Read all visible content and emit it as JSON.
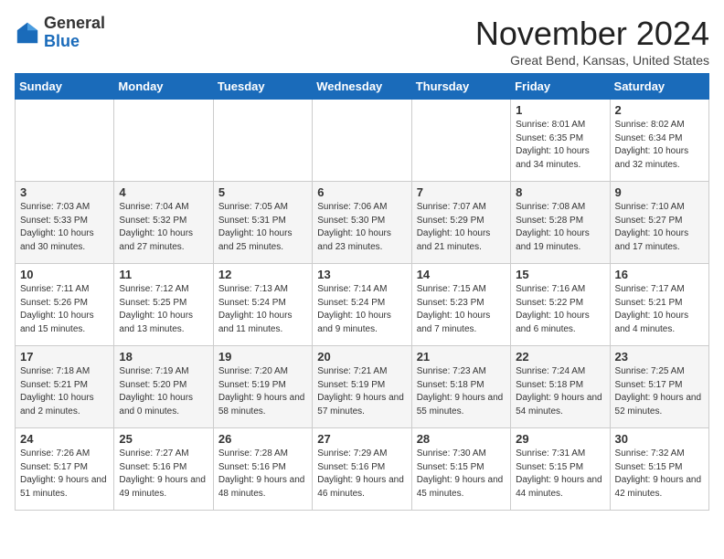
{
  "logo": {
    "general": "General",
    "blue": "Blue"
  },
  "title": "November 2024",
  "location": "Great Bend, Kansas, United States",
  "days_of_week": [
    "Sunday",
    "Monday",
    "Tuesday",
    "Wednesday",
    "Thursday",
    "Friday",
    "Saturday"
  ],
  "weeks": [
    [
      {
        "day": "",
        "info": ""
      },
      {
        "day": "",
        "info": ""
      },
      {
        "day": "",
        "info": ""
      },
      {
        "day": "",
        "info": ""
      },
      {
        "day": "",
        "info": ""
      },
      {
        "day": "1",
        "info": "Sunrise: 8:01 AM\nSunset: 6:35 PM\nDaylight: 10 hours and 34 minutes."
      },
      {
        "day": "2",
        "info": "Sunrise: 8:02 AM\nSunset: 6:34 PM\nDaylight: 10 hours and 32 minutes."
      }
    ],
    [
      {
        "day": "3",
        "info": "Sunrise: 7:03 AM\nSunset: 5:33 PM\nDaylight: 10 hours and 30 minutes."
      },
      {
        "day": "4",
        "info": "Sunrise: 7:04 AM\nSunset: 5:32 PM\nDaylight: 10 hours and 27 minutes."
      },
      {
        "day": "5",
        "info": "Sunrise: 7:05 AM\nSunset: 5:31 PM\nDaylight: 10 hours and 25 minutes."
      },
      {
        "day": "6",
        "info": "Sunrise: 7:06 AM\nSunset: 5:30 PM\nDaylight: 10 hours and 23 minutes."
      },
      {
        "day": "7",
        "info": "Sunrise: 7:07 AM\nSunset: 5:29 PM\nDaylight: 10 hours and 21 minutes."
      },
      {
        "day": "8",
        "info": "Sunrise: 7:08 AM\nSunset: 5:28 PM\nDaylight: 10 hours and 19 minutes."
      },
      {
        "day": "9",
        "info": "Sunrise: 7:10 AM\nSunset: 5:27 PM\nDaylight: 10 hours and 17 minutes."
      }
    ],
    [
      {
        "day": "10",
        "info": "Sunrise: 7:11 AM\nSunset: 5:26 PM\nDaylight: 10 hours and 15 minutes."
      },
      {
        "day": "11",
        "info": "Sunrise: 7:12 AM\nSunset: 5:25 PM\nDaylight: 10 hours and 13 minutes."
      },
      {
        "day": "12",
        "info": "Sunrise: 7:13 AM\nSunset: 5:24 PM\nDaylight: 10 hours and 11 minutes."
      },
      {
        "day": "13",
        "info": "Sunrise: 7:14 AM\nSunset: 5:24 PM\nDaylight: 10 hours and 9 minutes."
      },
      {
        "day": "14",
        "info": "Sunrise: 7:15 AM\nSunset: 5:23 PM\nDaylight: 10 hours and 7 minutes."
      },
      {
        "day": "15",
        "info": "Sunrise: 7:16 AM\nSunset: 5:22 PM\nDaylight: 10 hours and 6 minutes."
      },
      {
        "day": "16",
        "info": "Sunrise: 7:17 AM\nSunset: 5:21 PM\nDaylight: 10 hours and 4 minutes."
      }
    ],
    [
      {
        "day": "17",
        "info": "Sunrise: 7:18 AM\nSunset: 5:21 PM\nDaylight: 10 hours and 2 minutes."
      },
      {
        "day": "18",
        "info": "Sunrise: 7:19 AM\nSunset: 5:20 PM\nDaylight: 10 hours and 0 minutes."
      },
      {
        "day": "19",
        "info": "Sunrise: 7:20 AM\nSunset: 5:19 PM\nDaylight: 9 hours and 58 minutes."
      },
      {
        "day": "20",
        "info": "Sunrise: 7:21 AM\nSunset: 5:19 PM\nDaylight: 9 hours and 57 minutes."
      },
      {
        "day": "21",
        "info": "Sunrise: 7:23 AM\nSunset: 5:18 PM\nDaylight: 9 hours and 55 minutes."
      },
      {
        "day": "22",
        "info": "Sunrise: 7:24 AM\nSunset: 5:18 PM\nDaylight: 9 hours and 54 minutes."
      },
      {
        "day": "23",
        "info": "Sunrise: 7:25 AM\nSunset: 5:17 PM\nDaylight: 9 hours and 52 minutes."
      }
    ],
    [
      {
        "day": "24",
        "info": "Sunrise: 7:26 AM\nSunset: 5:17 PM\nDaylight: 9 hours and 51 minutes."
      },
      {
        "day": "25",
        "info": "Sunrise: 7:27 AM\nSunset: 5:16 PM\nDaylight: 9 hours and 49 minutes."
      },
      {
        "day": "26",
        "info": "Sunrise: 7:28 AM\nSunset: 5:16 PM\nDaylight: 9 hours and 48 minutes."
      },
      {
        "day": "27",
        "info": "Sunrise: 7:29 AM\nSunset: 5:16 PM\nDaylight: 9 hours and 46 minutes."
      },
      {
        "day": "28",
        "info": "Sunrise: 7:30 AM\nSunset: 5:15 PM\nDaylight: 9 hours and 45 minutes."
      },
      {
        "day": "29",
        "info": "Sunrise: 7:31 AM\nSunset: 5:15 PM\nDaylight: 9 hours and 44 minutes."
      },
      {
        "day": "30",
        "info": "Sunrise: 7:32 AM\nSunset: 5:15 PM\nDaylight: 9 hours and 42 minutes."
      }
    ]
  ]
}
